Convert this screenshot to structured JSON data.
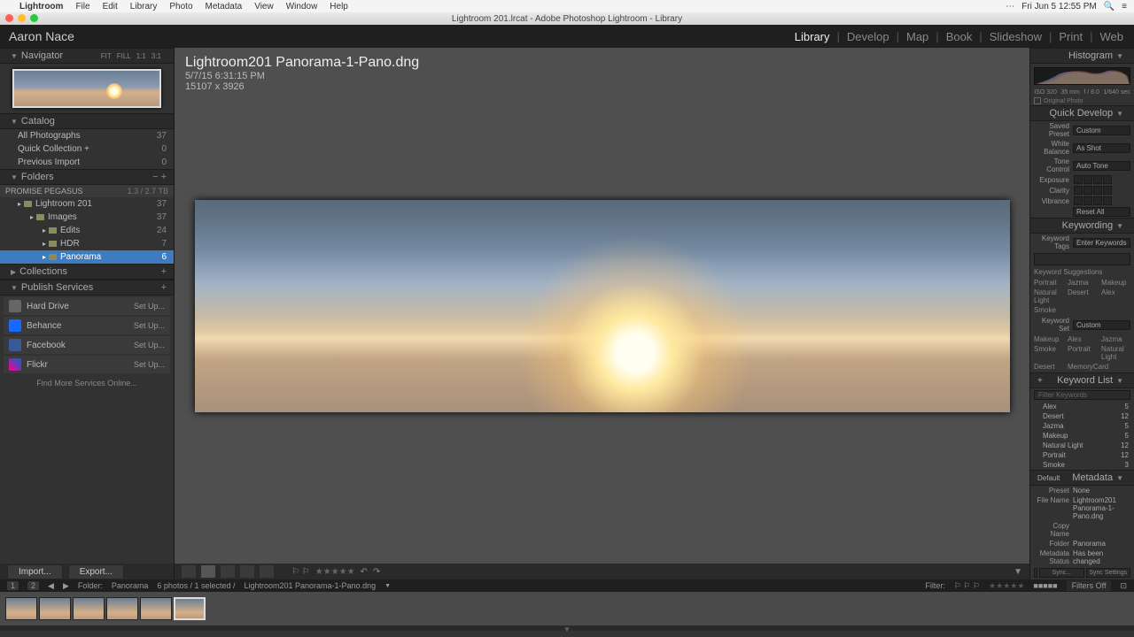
{
  "mac": {
    "app": "Lightroom",
    "menus": [
      "File",
      "Edit",
      "Library",
      "Photo",
      "Metadata",
      "View",
      "Window",
      "Help"
    ],
    "clock": "Fri Jun 5  12:55 PM",
    "title": "Lightroom 201.lrcat - Adobe Photoshop Lightroom - Library"
  },
  "identity": "Aaron Nace",
  "modules": [
    "Library",
    "Develop",
    "Map",
    "Book",
    "Slideshow",
    "Print",
    "Web"
  ],
  "active_module": "Library",
  "navigator": {
    "title": "Navigator",
    "opts": [
      "FIT",
      "FILL",
      "1:1",
      "3:1"
    ]
  },
  "catalog": {
    "title": "Catalog",
    "items": [
      {
        "label": "All Photographs",
        "count": "37"
      },
      {
        "label": "Quick Collection  +",
        "count": "0"
      },
      {
        "label": "Previous Import",
        "count": "0"
      }
    ]
  },
  "folders": {
    "title": "Folders",
    "volume": {
      "name": "PROMISE PEGASUS",
      "size": "1.3 / 2.7 TB"
    },
    "tree": [
      {
        "label": "Lightroom 201",
        "count": "37",
        "level": 1
      },
      {
        "label": "Images",
        "count": "37",
        "level": 2
      },
      {
        "label": "Edits",
        "count": "24",
        "level": 3
      },
      {
        "label": "HDR",
        "count": "7",
        "level": 3
      },
      {
        "label": "Panorama",
        "count": "6",
        "level": 3,
        "selected": true
      }
    ]
  },
  "collections": {
    "title": "Collections"
  },
  "publish": {
    "title": "Publish Services",
    "items": [
      {
        "name": "Hard Drive",
        "cls": "svc-hd",
        "setup": "Set Up..."
      },
      {
        "name": "Behance",
        "cls": "svc-be",
        "setup": "Set Up..."
      },
      {
        "name": "Facebook",
        "cls": "svc-fb",
        "setup": "Set Up..."
      },
      {
        "name": "Flickr",
        "cls": "svc-fl",
        "setup": "Set Up..."
      }
    ],
    "findmore": "Find More Services Online..."
  },
  "image": {
    "filename": "Lightroom201 Panorama-1-Pano.dng",
    "datetime": "5/7/15 6:31:15 PM",
    "dimensions": "15107 x 3926"
  },
  "toolbar": {
    "import": "Import...",
    "export": "Export..."
  },
  "histogram": {
    "title": "Histogram",
    "meta": [
      "ISO 320",
      "35 mm",
      "f / 8.0",
      "1/640 sec"
    ],
    "origphoto": "Original Photo"
  },
  "quickdev": {
    "title": "Quick Develop",
    "preset_lbl": "Saved Preset",
    "preset_val": "Custom",
    "wb_lbl": "White Balance",
    "wb_val": "As Shot",
    "tone_lbl": "Tone Control",
    "tone_val": "Auto Tone",
    "exposure": "Exposure",
    "clarity": "Clarity",
    "vibrance": "Vibrance",
    "reset": "Reset All"
  },
  "keywording": {
    "title": "Keywording",
    "tags_lbl": "Keyword Tags",
    "tags_val": "Enter Keywords",
    "sugg_lbl": "Keyword Suggestions",
    "suggestions": [
      "Portrait",
      "Jazma",
      "Makeup",
      "Natural Light",
      "Desert",
      "Alex",
      "Smoke"
    ],
    "set_lbl": "Keyword Set",
    "set_val": "Custom",
    "set_items": [
      "Makeup",
      "Alex",
      "Jazma",
      "Smoke",
      "Portrait",
      "Natural Light",
      "Desert",
      "MemoryCard"
    ]
  },
  "keywordlist": {
    "title": "Keyword List",
    "filter_placeholder": "Filter Keywords",
    "items": [
      {
        "name": "Alex",
        "count": "5"
      },
      {
        "name": "Desert",
        "count": "12"
      },
      {
        "name": "Jazma",
        "count": "5"
      },
      {
        "name": "Makeup",
        "count": "5"
      },
      {
        "name": "Natural Light",
        "count": "12"
      },
      {
        "name": "Portrait",
        "count": "12"
      },
      {
        "name": "Smoke",
        "count": "3"
      }
    ]
  },
  "metadata": {
    "title": "Metadata",
    "default": "Default",
    "preset_lbl": "Preset",
    "preset_val": "None",
    "filename_lbl": "File Name",
    "filename_val": "Lightroom201 Panorama-1-Pano.dng",
    "copyname_lbl": "Copy Name",
    "copyname_val": "",
    "folder_lbl": "Folder",
    "folder_val": "Panorama",
    "status_lbl": "Metadata Status",
    "status_val": "Has been changed"
  },
  "sync": {
    "sync": "Sync...",
    "settings": "Sync Settings"
  },
  "infobar": {
    "badge": "1",
    "screens": "2",
    "folder_lbl": "Folder:",
    "folder": "Panorama",
    "count": "6 photos / 1 selected /",
    "filename": "Lightroom201 Panorama-1-Pano.dng",
    "filter": "Filter:",
    "filtersoff": "Filters Off"
  },
  "filmstrip": {
    "count": 6,
    "selected": 5
  }
}
